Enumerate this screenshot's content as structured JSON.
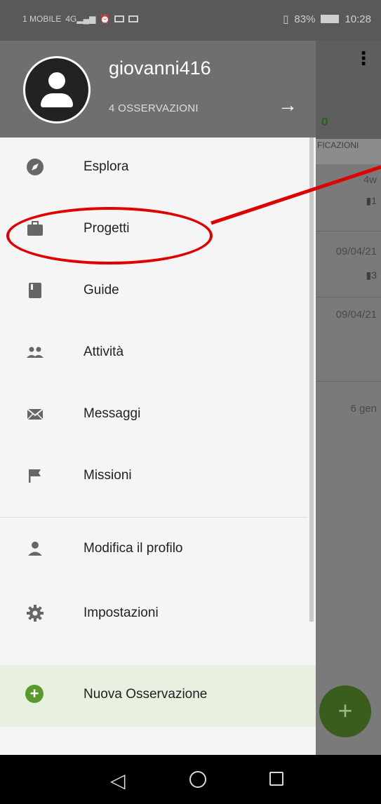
{
  "status_bar": {
    "carrier": "1 MOBILE",
    "network": "4G",
    "battery": "83%",
    "time": "10:28"
  },
  "drawer": {
    "username": "giovanni416",
    "observations": "4 OSSERVAZIONI",
    "items": [
      {
        "label": "Esplora",
        "icon": "compass-icon"
      },
      {
        "label": "Progetti",
        "icon": "briefcase-icon"
      },
      {
        "label": "Guide",
        "icon": "book-icon"
      },
      {
        "label": "Attività",
        "icon": "people-icon"
      },
      {
        "label": "Messaggi",
        "icon": "envelope-icon"
      },
      {
        "label": "Missioni",
        "icon": "flag-icon"
      },
      {
        "label": "Modifica il profilo",
        "icon": "person-icon"
      },
      {
        "label": "Impostazioni",
        "icon": "gear-icon"
      }
    ],
    "new_observation": "Nuova Osservazione"
  },
  "background": {
    "count": "0",
    "tab_label": "FICAZIONI",
    "rows": [
      {
        "date": "4w",
        "badge": "1"
      },
      {
        "date": "09/04/21",
        "badge": "3"
      },
      {
        "date": "09/04/21",
        "badge": ""
      },
      {
        "date": "6 gen",
        "badge": ""
      }
    ],
    "fab": "+"
  },
  "colors": {
    "accent": "#5a9a2c",
    "annotation": "#e00000"
  }
}
